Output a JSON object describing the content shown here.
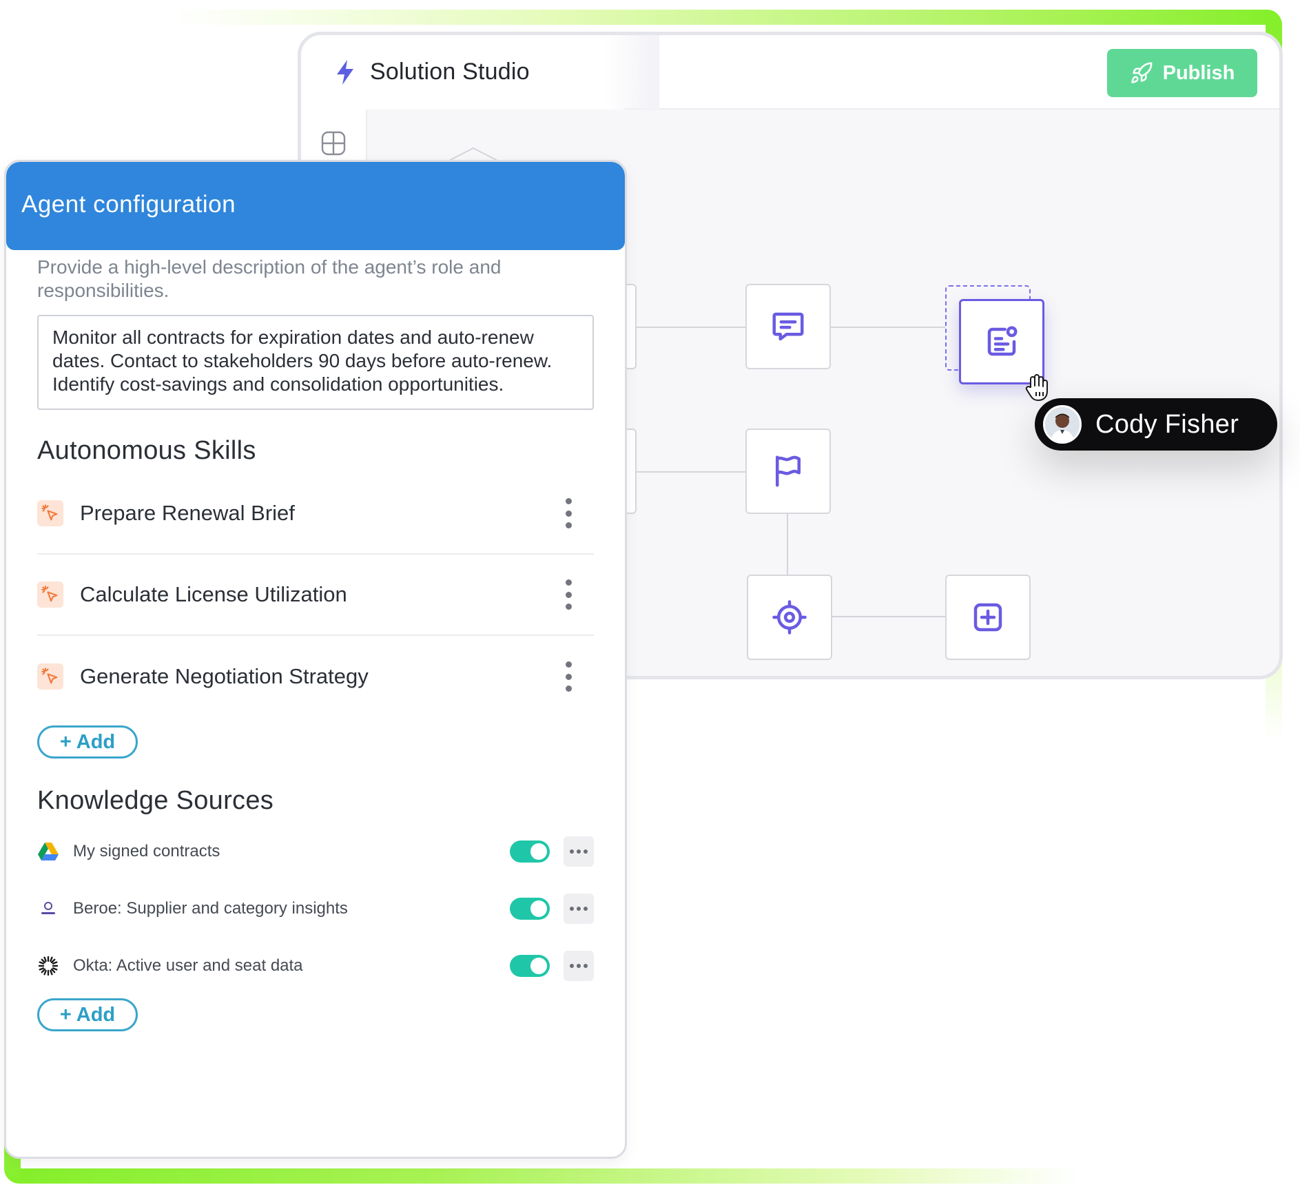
{
  "studio": {
    "title": "Solution Studio",
    "publish_label": "Publish"
  },
  "collaborator": {
    "name": "Cody Fisher"
  },
  "panel": {
    "title": "Agent configuration",
    "description_hint": "Provide a high-level description of the agent’s role and responsibilities.",
    "description_value": "Monitor all contracts for expiration dates and auto-renew dates. Contact to stakeholders 90 days before auto-renew. Identify cost-savings and consolidation opportunities.",
    "skills_title": "Autonomous Skills",
    "skills": [
      {
        "label": "Prepare Renewal Brief",
        "icon": "sparkle-cursor-icon"
      },
      {
        "label": "Calculate License Utilization",
        "icon": "sparkle-cursor-icon"
      },
      {
        "label": "Generate Negotiation Strategy",
        "icon": "sparkle-cursor-icon"
      }
    ],
    "skills_add_label": "+ Add",
    "knowledge_title": "Knowledge Sources",
    "knowledge": [
      {
        "label": "My signed contracts",
        "icon": "google-drive-icon",
        "enabled": true
      },
      {
        "label": "Beroe: Supplier and category insights",
        "icon": "beroe-logo-icon",
        "enabled": true
      },
      {
        "label": "Okta: Active user and seat data",
        "icon": "okta-logo-icon",
        "enabled": true
      }
    ],
    "knowledge_add_label": "+ Add"
  },
  "colors": {
    "accent_blue": "#2f86dc",
    "publish_green": "#5fd896",
    "toggle_teal": "#1fc7a8",
    "node_purple": "#6a5be2",
    "frame_green": "#84ef2a"
  }
}
